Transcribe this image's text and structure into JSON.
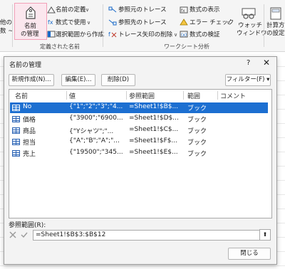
{
  "ribbon": {
    "left_partial_1": "他の",
    "left_partial_2": "数 ~",
    "name_manager_line1": "名前",
    "name_manager_line2": "の管理",
    "define_name": "名前の定義",
    "use_in_formula": "数式で使用",
    "create_from_selection": "選択範囲から作成",
    "defined_names_group": "定義された名前",
    "trace_precedents": "参照元のトレース",
    "trace_dependents": "参照先のトレース",
    "remove_arrows": "トレース矢印の削除",
    "show_formulas": "数式の表示",
    "error_checking": "エラー チェック",
    "evaluate_formula": "数式の検証",
    "formula_auditing_group": "ワークシート分析",
    "watch_window_line1": "ウォッチ",
    "watch_window_line2": "ウィンドウ",
    "calc_options_line1": "計算方",
    "calc_options_line2": "の設定"
  },
  "dialog": {
    "title": "名前の管理",
    "help": "?",
    "close": "✕",
    "new_button": "新規作成(N)...",
    "edit_button": "編集(E)...",
    "delete_button": "削除(D)",
    "filter_button": "フィルター(F) ▾",
    "columns": {
      "name": "名前",
      "value": "値",
      "refers_to": "参照範囲",
      "scope": "範囲",
      "comment": "コメント"
    },
    "rows": [
      {
        "name": "No",
        "value": "{\"1\";\"2\";\"3\";\"4...",
        "refers": "=Sheet1!$B$...",
        "scope": "ブック"
      },
      {
        "name": "価格",
        "value": "{\"3900\";\"6900...",
        "refers": "=Sheet1!$D$...",
        "scope": "ブック"
      },
      {
        "name": "商品",
        "value": "{\"Yシャツ\";\"...",
        "refers": "=Sheet1!$C$...",
        "scope": "ブック"
      },
      {
        "name": "担当",
        "value": "{\"A\";\"B\";\"A\";\"...",
        "refers": "=Sheet1!$F$...",
        "scope": "ブック"
      },
      {
        "name": "売上",
        "value": "{\"19500\";\"345...",
        "refers": "=Sheet1!$E$...",
        "scope": "ブック"
      }
    ],
    "refers_label": "参照範囲(R):",
    "refers_value": "=Sheet1!$B$3:$B$12",
    "close_button": "閉じる"
  },
  "colors": {
    "selection": "#1c6fd1",
    "name_manager_highlight": "#f2a0b8",
    "table_icon": "#2a62b3"
  }
}
